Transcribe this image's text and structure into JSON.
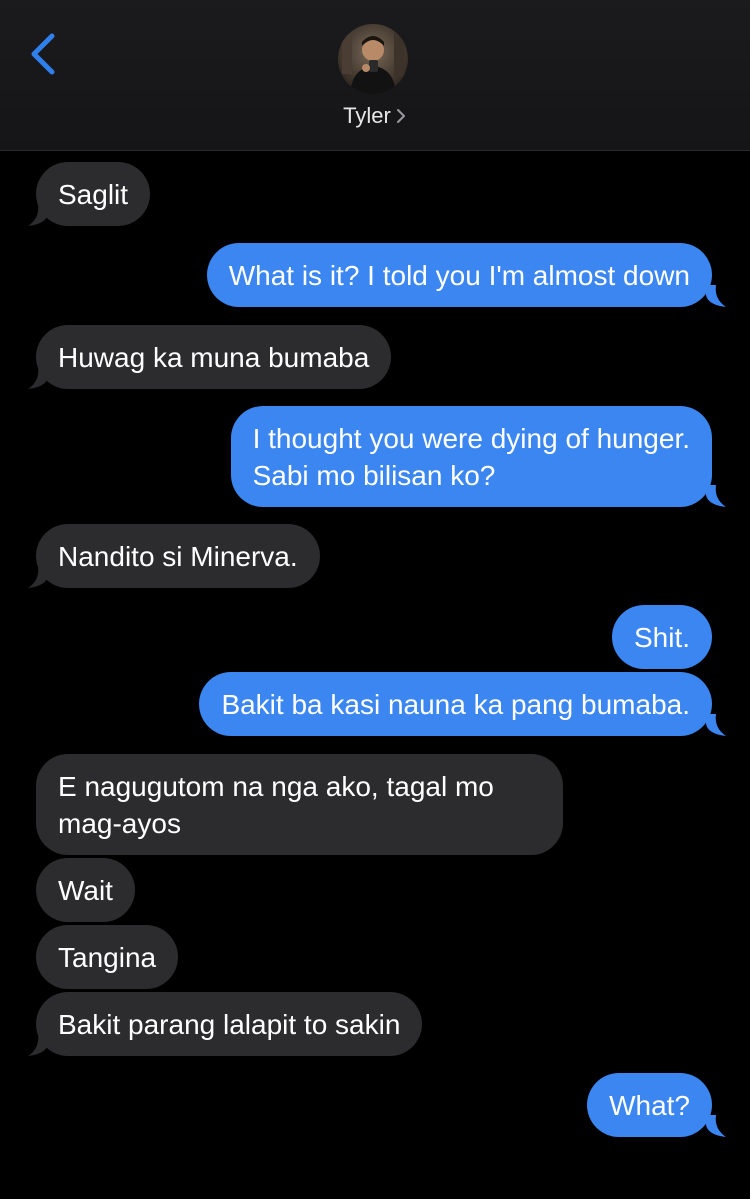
{
  "header": {
    "contact_name": "Tyler",
    "chevron": ">"
  },
  "icons": {
    "back": "chevron-left-icon",
    "contact_chevron": "chevron-right-icon"
  },
  "colors": {
    "background": "#000000",
    "incoming_bubble": "#2c2c2e",
    "outgoing_bubble": "#3b86f0",
    "accent": "#2f80ed"
  },
  "messages": [
    {
      "from": "them",
      "lines": [
        "Saglit"
      ]
    },
    {
      "from": "me",
      "lines": [
        "What is it? I told you I'm almost down"
      ]
    },
    {
      "from": "them",
      "lines": [
        "Huwag ka muna bumaba"
      ]
    },
    {
      "from": "me",
      "lines": [
        "I thought you were dying of hunger.",
        "Sabi mo bilisan ko?"
      ]
    },
    {
      "from": "them",
      "lines": [
        "Nandito si Minerva."
      ]
    },
    {
      "from": "me",
      "lines": [
        "Shit."
      ]
    },
    {
      "from": "me",
      "lines": [
        "Bakit ba kasi nauna ka pang bumaba."
      ]
    },
    {
      "from": "them",
      "lines": [
        "E nagugutom na nga ako, tagal mo",
        "mag-ayos"
      ]
    },
    {
      "from": "them",
      "lines": [
        "Wait"
      ]
    },
    {
      "from": "them",
      "lines": [
        "Tangina"
      ]
    },
    {
      "from": "them",
      "lines": [
        "Bakit parang lalapit to sakin"
      ]
    },
    {
      "from": "me",
      "lines": [
        "What?"
      ]
    }
  ]
}
